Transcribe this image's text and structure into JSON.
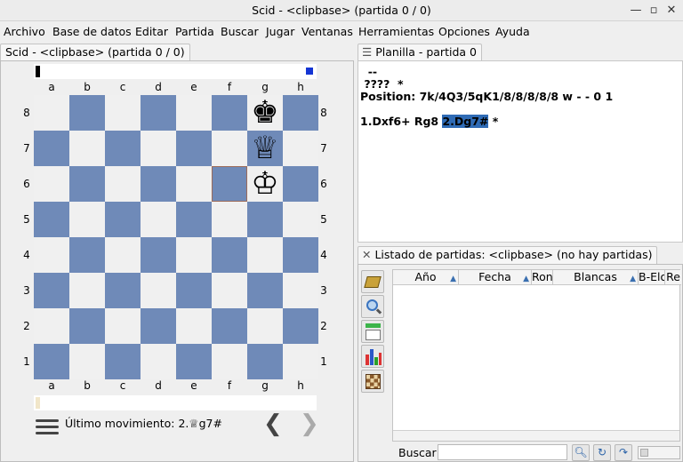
{
  "window": {
    "title": "Scid - <clipbase> (partida 0 / 0)"
  },
  "menu": [
    "Archivo",
    "Base de datos",
    "Editar",
    "Partida",
    "Buscar",
    "Jugar",
    "Ventanas",
    "Herramientas",
    "Opciones",
    "Ayuda"
  ],
  "board_tab": {
    "label": "Scid - <clipbase> (partida 0 / 0)"
  },
  "board": {
    "files": [
      "a",
      "b",
      "c",
      "d",
      "e",
      "f",
      "g",
      "h"
    ],
    "ranks": [
      "8",
      "7",
      "6",
      "5",
      "4",
      "3",
      "2",
      "1"
    ],
    "light_color": "#f0f0f0",
    "dark_color": "#6f8ab8",
    "last_move_from": "f6",
    "pieces": [
      {
        "square": "g8",
        "glyph": "♚",
        "name": "black-king"
      },
      {
        "square": "g7",
        "glyph": "♕",
        "name": "white-queen"
      },
      {
        "square": "g6",
        "glyph": "♔",
        "name": "white-king"
      }
    ]
  },
  "status": {
    "last_move": "Último movimiento: 2.♕g7#"
  },
  "nav": {
    "prev": "❮",
    "next": "❯"
  },
  "notation_tab": {
    "label": "Planilla - partida 0"
  },
  "notation": {
    "line1": "  --",
    "line2": " ????  *",
    "line3": "Position: 7k/4Q3/5qK1/8/8/8/8/8 w - - 0 1",
    "move1": "1.Dxf6+ Rg8 ",
    "move2_current": "2.Dg7#",
    "result": " *"
  },
  "gamelist_tab": {
    "label": "Listado de partidas: <clipbase> (no hay partidas)"
  },
  "gamelist": {
    "columns": [
      "Año",
      "Fecha",
      "Ron",
      "Blancas",
      "B-Elo",
      "Re"
    ],
    "search_label": "Buscar",
    "search_value": ""
  }
}
